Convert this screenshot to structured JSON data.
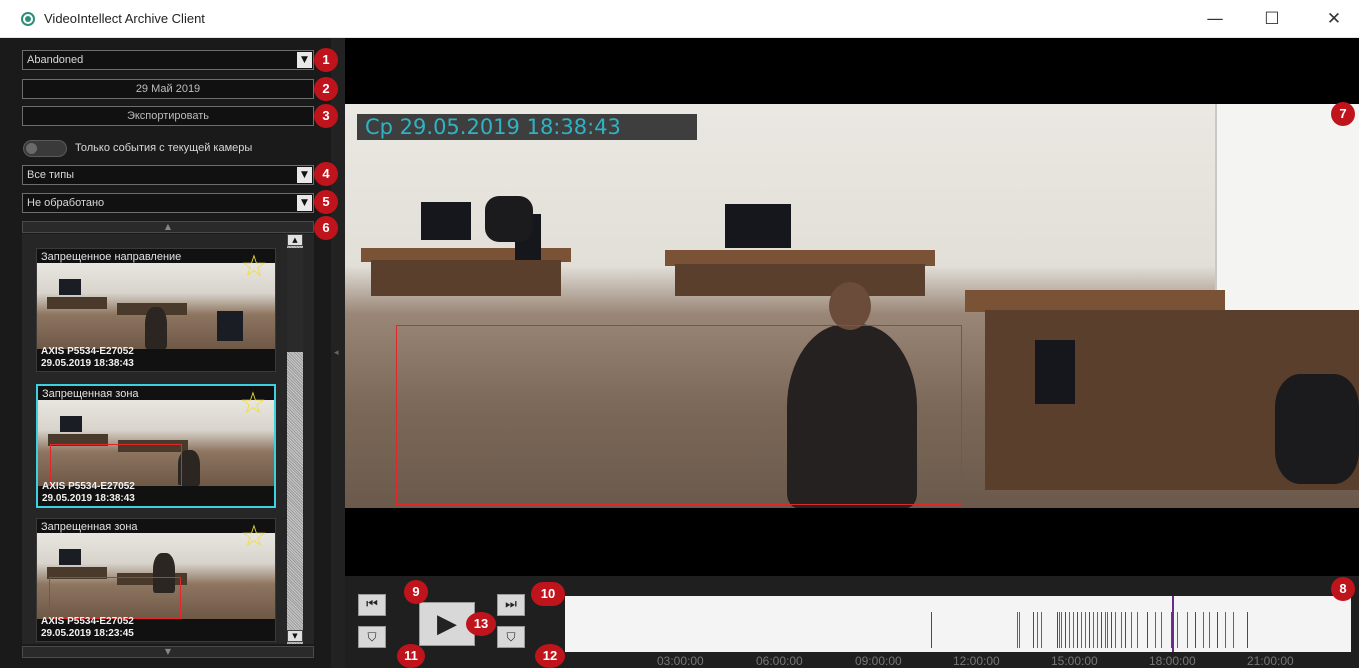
{
  "window": {
    "title": "VideoIntellect Archive Client",
    "minimize": "—",
    "maximize": "☐",
    "close": "✕"
  },
  "filters": {
    "event_dropdown": "Abandoned",
    "date_label": "29 Май 2019",
    "export_button": "Экспортировать",
    "current_camera_toggle_label": "Только события с текущей камеры",
    "type_dropdown": "Все типы",
    "status_dropdown": "Не обработано"
  },
  "events": [
    {
      "title": "Запрещенное направление",
      "camera": "AXIS P5534-E27052",
      "time": "29.05.2019 18:38:43"
    },
    {
      "title": "Запрещенная зона",
      "camera": "AXIS P5534-E27052",
      "time": "29.05.2019 18:38:43"
    },
    {
      "title": "Запрещенная зона",
      "camera": "AXIS P5534-E27052",
      "time": "29.05.2019 18:23:45"
    }
  ],
  "video": {
    "osd_timestamp": "Ср 29.05.2019 18:38:43"
  },
  "timeline": {
    "ticks": [
      "03:00:00",
      "06:00:00",
      "09:00:00",
      "12:00:00",
      "15:00:00",
      "18:00:00",
      "21:00:00"
    ]
  },
  "badges": [
    "1",
    "2",
    "3",
    "4",
    "5",
    "6",
    "7",
    "8",
    "9",
    "10",
    "11",
    "12",
    "13"
  ],
  "colors": {
    "badge": "#c0141c",
    "selected_border": "#3fd0e0",
    "osd_text": "#2fb3c3",
    "detection_box": "#e0282a",
    "timeline_mark": "#0f8a8a"
  }
}
